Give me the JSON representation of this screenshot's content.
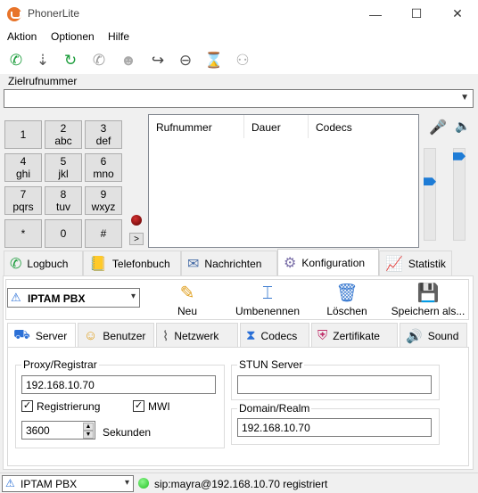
{
  "window": {
    "title": "PhonerLite",
    "controls": [
      "—",
      "☐",
      "✕"
    ]
  },
  "menu": [
    "Aktion",
    "Optionen",
    "Hilfe"
  ],
  "toolbar_icons": [
    "call-icon",
    "hold-icon",
    "transfer-icon",
    "redial-icon",
    "conference-icon",
    "forward-icon",
    "reject-icon",
    "dnd-icon",
    "record-icon"
  ],
  "destination": {
    "label": "Zielrufnummer",
    "value": ""
  },
  "keypad": [
    {
      "d": "1",
      "s": ""
    },
    {
      "d": "2",
      "s": "abc"
    },
    {
      "d": "3",
      "s": "def"
    },
    {
      "d": "4",
      "s": "ghi"
    },
    {
      "d": "5",
      "s": "jkl"
    },
    {
      "d": "6",
      "s": "mno"
    },
    {
      "d": "7",
      "s": "pqrs"
    },
    {
      "d": "8",
      "s": "tuv"
    },
    {
      "d": "9",
      "s": "wxyz"
    },
    {
      "d": "*",
      "s": ""
    },
    {
      "d": "0",
      "s": ""
    },
    {
      "d": "#",
      "s": ""
    }
  ],
  "keypad_expand": ">",
  "calls_table": {
    "columns": [
      "Rufnummer",
      "Dauer",
      "Codecs"
    ]
  },
  "volume": {
    "mic_level": 0.65,
    "speaker_level": 0.95
  },
  "main_tabs": [
    "Logbuch",
    "Telefonbuch",
    "Nachrichten",
    "Konfiguration",
    "Statistik"
  ],
  "active_main_tab": "Konfiguration",
  "provider": {
    "selected": "IPTAM PBX"
  },
  "actions": [
    "Neu",
    "Umbenennen",
    "Löschen",
    "Speichern als..."
  ],
  "sub_tabs": [
    "Server",
    "Benutzer",
    "Netzwerk",
    "Codecs",
    "Zertifikate",
    "Sound"
  ],
  "active_sub_tab": "Server",
  "server": {
    "proxy_group": "Proxy/Registrar",
    "proxy_value": "192.168.10.70",
    "registrierung_label": "Registrierung",
    "registrierung_checked": true,
    "mwi_label": "MWI",
    "mwi_checked": true,
    "seconds_value": "3600",
    "seconds_label": "Sekunden",
    "stun_group": "STUN Server",
    "stun_value": "",
    "domain_group": "Domain/Realm",
    "domain_value": "192.168.10.70"
  },
  "status": {
    "profile": "IPTAM PBX",
    "message": "sip:mayra@192.168.10.70 registriert",
    "color": "#22c022"
  }
}
